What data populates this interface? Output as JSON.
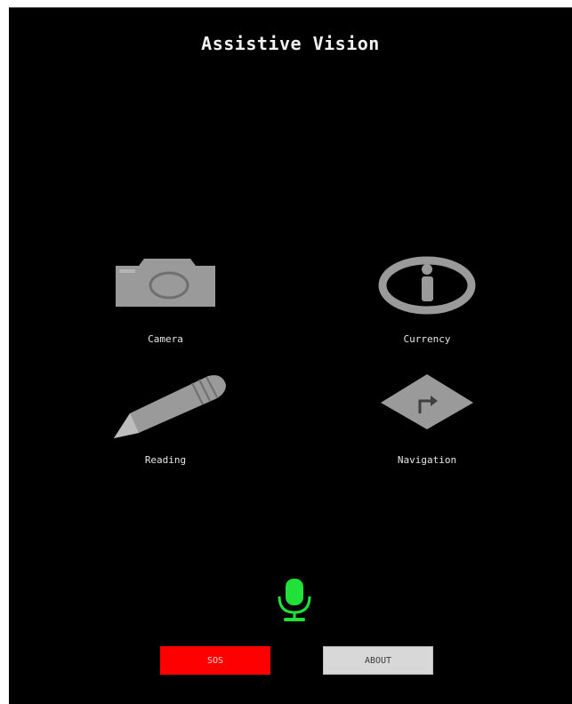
{
  "app": {
    "title": "Assistive Vision"
  },
  "features": {
    "camera": {
      "label": "Camera",
      "icon": "camera-icon"
    },
    "currency": {
      "label": "Currency",
      "icon": "info-icon"
    },
    "reading": {
      "label": "Reading",
      "icon": "pencil-icon"
    },
    "navigation": {
      "label": "Navigation",
      "icon": "directions-icon"
    }
  },
  "mic": {
    "icon": "microphone-icon",
    "color": "#22e03a"
  },
  "buttons": {
    "sos_label": "SOS",
    "about_label": "ABOUT"
  },
  "colors": {
    "background": "#000000",
    "icon_gray": "#9a9a9a",
    "sos": "#ff0000",
    "about": "#d8d8d8"
  }
}
